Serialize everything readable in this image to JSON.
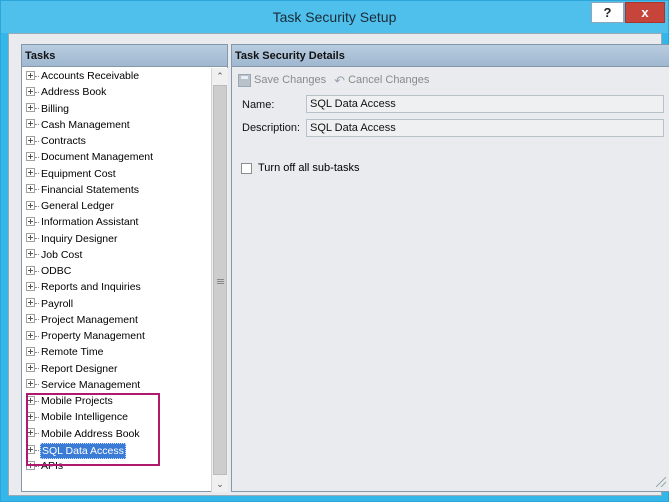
{
  "window": {
    "title": "Task Security Setup",
    "help_label": "?",
    "close_label": "x"
  },
  "tasks_panel": {
    "header": "Tasks",
    "items": [
      {
        "label": "Accounts Receivable"
      },
      {
        "label": "Address Book"
      },
      {
        "label": "Billing"
      },
      {
        "label": "Cash Management"
      },
      {
        "label": "Contracts"
      },
      {
        "label": "Document Management"
      },
      {
        "label": "Equipment Cost"
      },
      {
        "label": "Financial Statements"
      },
      {
        "label": "General Ledger"
      },
      {
        "label": "Information Assistant"
      },
      {
        "label": "Inquiry Designer"
      },
      {
        "label": "Job Cost"
      },
      {
        "label": "ODBC"
      },
      {
        "label": "Reports and Inquiries"
      },
      {
        "label": "Payroll"
      },
      {
        "label": "Project Management"
      },
      {
        "label": "Property Management"
      },
      {
        "label": "Remote Time"
      },
      {
        "label": "Report Designer"
      },
      {
        "label": "Service Management"
      },
      {
        "label": "Mobile Projects"
      },
      {
        "label": "Mobile Intelligence"
      },
      {
        "label": "Mobile Address Book"
      },
      {
        "label": "SQL Data Access",
        "selected": true
      },
      {
        "label": "APIs"
      }
    ]
  },
  "details_panel": {
    "header": "Task Security Details",
    "toolbar": {
      "save_label": "Save Changes",
      "cancel_label": "Cancel Changes"
    },
    "name_label": "Name:",
    "name_value": "SQL Data Access",
    "description_label": "Description:",
    "description_value": "SQL Data Access",
    "subtasks_checkbox_label": "Turn off all sub-tasks"
  },
  "colors": {
    "titlebar": "#4fc0ec",
    "selection": "#3a7bd5",
    "highlight_box": "#b0196e",
    "close_button": "#c7443a"
  }
}
